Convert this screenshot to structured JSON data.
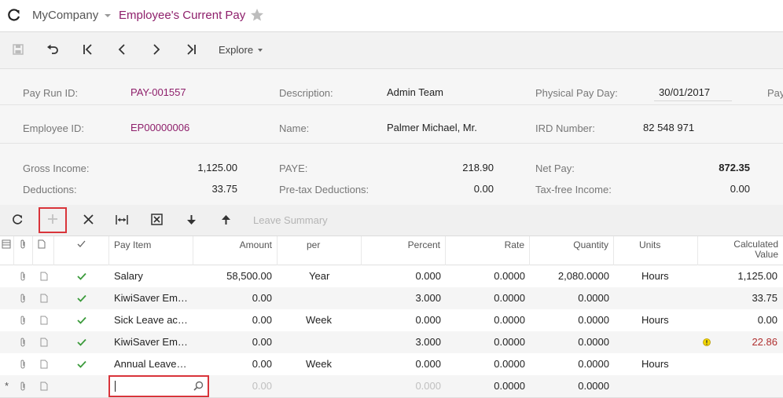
{
  "header": {
    "company": "MyCompany",
    "title": "Employee's Current Pay"
  },
  "toolbar": {
    "explore_label": "Explore"
  },
  "form": {
    "pay_run_id_label": "Pay Run ID:",
    "pay_run_id": "PAY-001557",
    "description_label": "Description:",
    "description": "Admin Team",
    "physical_pay_day_label": "Physical Pay Day:",
    "physical_pay_day": "30/01/2017",
    "cut_label": "Pay",
    "employee_id_label": "Employee ID:",
    "employee_id": "EP00000006",
    "name_label": "Name:",
    "name": "Palmer Michael, Mr.",
    "ird_label": "IRD Number:",
    "ird": "82 548 971",
    "gross_income_label": "Gross Income:",
    "gross_income": "1,125.00",
    "paye_label": "PAYE:",
    "paye": "218.90",
    "net_pay_label": "Net Pay:",
    "net_pay": "872.35",
    "deductions_label": "Deductions:",
    "deductions": "33.75",
    "pretax_label": "Pre-tax Deductions:",
    "pretax": "0.00",
    "taxfree_label": "Tax-free Income:",
    "taxfree": "0.00"
  },
  "gridbar": {
    "leave_summary": "Leave Summary"
  },
  "grid": {
    "headers": {
      "pay_item": "Pay Item",
      "amount": "Amount",
      "per": "per",
      "percent": "Percent",
      "rate": "Rate",
      "quantity": "Quantity",
      "units": "Units",
      "calculated_1": "Calculated",
      "calculated_2": "Value"
    },
    "rows": [
      {
        "item": "Salary",
        "amount": "58,500.00",
        "per": "Year",
        "percent": "0.000",
        "rate": "0.0000",
        "quantity": "2,080.0000",
        "units": "Hours",
        "value": "1,125.00"
      },
      {
        "item": "KiwiSaver Em…",
        "amount": "0.00",
        "per": "",
        "percent": "3.000",
        "rate": "0.0000",
        "quantity": "0.0000",
        "units": "",
        "value": "33.75"
      },
      {
        "item": "Sick Leave ac…",
        "amount": "0.00",
        "per": "Week",
        "percent": "0.000",
        "rate": "0.0000",
        "quantity": "0.0000",
        "units": "Hours",
        "value": "0.00"
      },
      {
        "item": "KiwiSaver Em…",
        "amount": "0.00",
        "per": "",
        "percent": "3.000",
        "rate": "0.0000",
        "quantity": "0.0000",
        "units": "",
        "value": "22.86"
      },
      {
        "item": "Annual Leave…",
        "amount": "0.00",
        "per": "Week",
        "percent": "0.000",
        "rate": "0.0000",
        "quantity": "0.0000",
        "units": "Hours",
        "value": ""
      }
    ],
    "new_row": {
      "amount": "0.00",
      "percent": "0.000",
      "rate": "0.0000",
      "quantity": "0.0000"
    }
  }
}
